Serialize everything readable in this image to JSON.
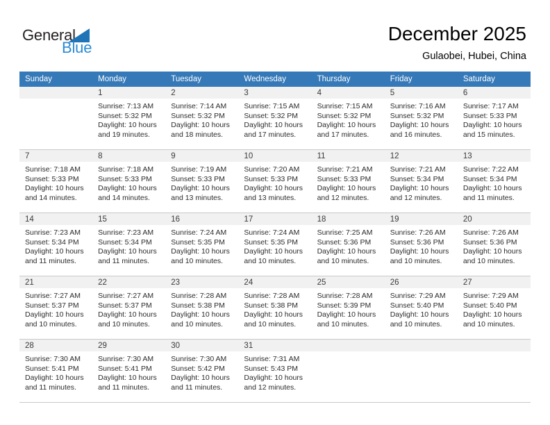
{
  "brand": {
    "name_primary": "General",
    "name_secondary": "Blue",
    "triangle_icon": "triangle-icon",
    "primary_color": "#231f20",
    "secondary_color": "#2a8bd4"
  },
  "header": {
    "month_title": "December 2025",
    "location": "Gulaobei, Hubei, China"
  },
  "calendar": {
    "header_color": "#3579b8",
    "day_band_color": "#f1f1f1",
    "weekdays": [
      "Sunday",
      "Monday",
      "Tuesday",
      "Wednesday",
      "Thursday",
      "Friday",
      "Saturday"
    ],
    "weeks": [
      [
        {
          "day": "",
          "empty": true,
          "sunrise": "",
          "sunset": "",
          "daylight_line1": "",
          "daylight_line2": ""
        },
        {
          "day": "1",
          "empty": false,
          "sunrise": "Sunrise: 7:13 AM",
          "sunset": "Sunset: 5:32 PM",
          "daylight_line1": "Daylight: 10 hours",
          "daylight_line2": "and 19 minutes."
        },
        {
          "day": "2",
          "empty": false,
          "sunrise": "Sunrise: 7:14 AM",
          "sunset": "Sunset: 5:32 PM",
          "daylight_line1": "Daylight: 10 hours",
          "daylight_line2": "and 18 minutes."
        },
        {
          "day": "3",
          "empty": false,
          "sunrise": "Sunrise: 7:15 AM",
          "sunset": "Sunset: 5:32 PM",
          "daylight_line1": "Daylight: 10 hours",
          "daylight_line2": "and 17 minutes."
        },
        {
          "day": "4",
          "empty": false,
          "sunrise": "Sunrise: 7:15 AM",
          "sunset": "Sunset: 5:32 PM",
          "daylight_line1": "Daylight: 10 hours",
          "daylight_line2": "and 17 minutes."
        },
        {
          "day": "5",
          "empty": false,
          "sunrise": "Sunrise: 7:16 AM",
          "sunset": "Sunset: 5:32 PM",
          "daylight_line1": "Daylight: 10 hours",
          "daylight_line2": "and 16 minutes."
        },
        {
          "day": "6",
          "empty": false,
          "sunrise": "Sunrise: 7:17 AM",
          "sunset": "Sunset: 5:33 PM",
          "daylight_line1": "Daylight: 10 hours",
          "daylight_line2": "and 15 minutes."
        }
      ],
      [
        {
          "day": "7",
          "empty": false,
          "sunrise": "Sunrise: 7:18 AM",
          "sunset": "Sunset: 5:33 PM",
          "daylight_line1": "Daylight: 10 hours",
          "daylight_line2": "and 14 minutes."
        },
        {
          "day": "8",
          "empty": false,
          "sunrise": "Sunrise: 7:18 AM",
          "sunset": "Sunset: 5:33 PM",
          "daylight_line1": "Daylight: 10 hours",
          "daylight_line2": "and 14 minutes."
        },
        {
          "day": "9",
          "empty": false,
          "sunrise": "Sunrise: 7:19 AM",
          "sunset": "Sunset: 5:33 PM",
          "daylight_line1": "Daylight: 10 hours",
          "daylight_line2": "and 13 minutes."
        },
        {
          "day": "10",
          "empty": false,
          "sunrise": "Sunrise: 7:20 AM",
          "sunset": "Sunset: 5:33 PM",
          "daylight_line1": "Daylight: 10 hours",
          "daylight_line2": "and 13 minutes."
        },
        {
          "day": "11",
          "empty": false,
          "sunrise": "Sunrise: 7:21 AM",
          "sunset": "Sunset: 5:33 PM",
          "daylight_line1": "Daylight: 10 hours",
          "daylight_line2": "and 12 minutes."
        },
        {
          "day": "12",
          "empty": false,
          "sunrise": "Sunrise: 7:21 AM",
          "sunset": "Sunset: 5:34 PM",
          "daylight_line1": "Daylight: 10 hours",
          "daylight_line2": "and 12 minutes."
        },
        {
          "day": "13",
          "empty": false,
          "sunrise": "Sunrise: 7:22 AM",
          "sunset": "Sunset: 5:34 PM",
          "daylight_line1": "Daylight: 10 hours",
          "daylight_line2": "and 11 minutes."
        }
      ],
      [
        {
          "day": "14",
          "empty": false,
          "sunrise": "Sunrise: 7:23 AM",
          "sunset": "Sunset: 5:34 PM",
          "daylight_line1": "Daylight: 10 hours",
          "daylight_line2": "and 11 minutes."
        },
        {
          "day": "15",
          "empty": false,
          "sunrise": "Sunrise: 7:23 AM",
          "sunset": "Sunset: 5:34 PM",
          "daylight_line1": "Daylight: 10 hours",
          "daylight_line2": "and 11 minutes."
        },
        {
          "day": "16",
          "empty": false,
          "sunrise": "Sunrise: 7:24 AM",
          "sunset": "Sunset: 5:35 PM",
          "daylight_line1": "Daylight: 10 hours",
          "daylight_line2": "and 10 minutes."
        },
        {
          "day": "17",
          "empty": false,
          "sunrise": "Sunrise: 7:24 AM",
          "sunset": "Sunset: 5:35 PM",
          "daylight_line1": "Daylight: 10 hours",
          "daylight_line2": "and 10 minutes."
        },
        {
          "day": "18",
          "empty": false,
          "sunrise": "Sunrise: 7:25 AM",
          "sunset": "Sunset: 5:36 PM",
          "daylight_line1": "Daylight: 10 hours",
          "daylight_line2": "and 10 minutes."
        },
        {
          "day": "19",
          "empty": false,
          "sunrise": "Sunrise: 7:26 AM",
          "sunset": "Sunset: 5:36 PM",
          "daylight_line1": "Daylight: 10 hours",
          "daylight_line2": "and 10 minutes."
        },
        {
          "day": "20",
          "empty": false,
          "sunrise": "Sunrise: 7:26 AM",
          "sunset": "Sunset: 5:36 PM",
          "daylight_line1": "Daylight: 10 hours",
          "daylight_line2": "and 10 minutes."
        }
      ],
      [
        {
          "day": "21",
          "empty": false,
          "sunrise": "Sunrise: 7:27 AM",
          "sunset": "Sunset: 5:37 PM",
          "daylight_line1": "Daylight: 10 hours",
          "daylight_line2": "and 10 minutes."
        },
        {
          "day": "22",
          "empty": false,
          "sunrise": "Sunrise: 7:27 AM",
          "sunset": "Sunset: 5:37 PM",
          "daylight_line1": "Daylight: 10 hours",
          "daylight_line2": "and 10 minutes."
        },
        {
          "day": "23",
          "empty": false,
          "sunrise": "Sunrise: 7:28 AM",
          "sunset": "Sunset: 5:38 PM",
          "daylight_line1": "Daylight: 10 hours",
          "daylight_line2": "and 10 minutes."
        },
        {
          "day": "24",
          "empty": false,
          "sunrise": "Sunrise: 7:28 AM",
          "sunset": "Sunset: 5:38 PM",
          "daylight_line1": "Daylight: 10 hours",
          "daylight_line2": "and 10 minutes."
        },
        {
          "day": "25",
          "empty": false,
          "sunrise": "Sunrise: 7:28 AM",
          "sunset": "Sunset: 5:39 PM",
          "daylight_line1": "Daylight: 10 hours",
          "daylight_line2": "and 10 minutes."
        },
        {
          "day": "26",
          "empty": false,
          "sunrise": "Sunrise: 7:29 AM",
          "sunset": "Sunset: 5:40 PM",
          "daylight_line1": "Daylight: 10 hours",
          "daylight_line2": "and 10 minutes."
        },
        {
          "day": "27",
          "empty": false,
          "sunrise": "Sunrise: 7:29 AM",
          "sunset": "Sunset: 5:40 PM",
          "daylight_line1": "Daylight: 10 hours",
          "daylight_line2": "and 10 minutes."
        }
      ],
      [
        {
          "day": "28",
          "empty": false,
          "sunrise": "Sunrise: 7:30 AM",
          "sunset": "Sunset: 5:41 PM",
          "daylight_line1": "Daylight: 10 hours",
          "daylight_line2": "and 11 minutes."
        },
        {
          "day": "29",
          "empty": false,
          "sunrise": "Sunrise: 7:30 AM",
          "sunset": "Sunset: 5:41 PM",
          "daylight_line1": "Daylight: 10 hours",
          "daylight_line2": "and 11 minutes."
        },
        {
          "day": "30",
          "empty": false,
          "sunrise": "Sunrise: 7:30 AM",
          "sunset": "Sunset: 5:42 PM",
          "daylight_line1": "Daylight: 10 hours",
          "daylight_line2": "and 11 minutes."
        },
        {
          "day": "31",
          "empty": false,
          "sunrise": "Sunrise: 7:31 AM",
          "sunset": "Sunset: 5:43 PM",
          "daylight_line1": "Daylight: 10 hours",
          "daylight_line2": "and 12 minutes."
        },
        {
          "day": "",
          "empty": true,
          "sunrise": "",
          "sunset": "",
          "daylight_line1": "",
          "daylight_line2": ""
        },
        {
          "day": "",
          "empty": true,
          "sunrise": "",
          "sunset": "",
          "daylight_line1": "",
          "daylight_line2": ""
        },
        {
          "day": "",
          "empty": true,
          "sunrise": "",
          "sunset": "",
          "daylight_line1": "",
          "daylight_line2": ""
        }
      ]
    ]
  }
}
